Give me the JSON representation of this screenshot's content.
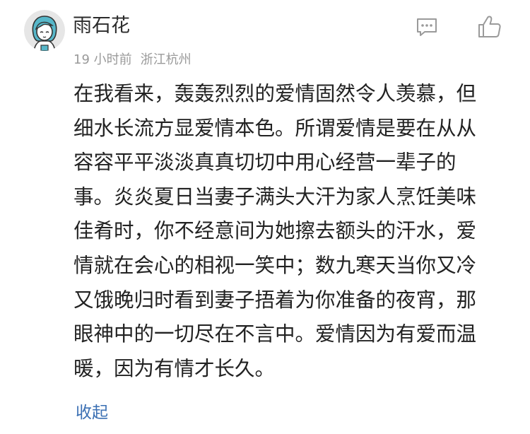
{
  "comment": {
    "username": "雨石花",
    "time": "19 小时前",
    "location": "浙江杭州",
    "avatar_icon": "avatar-icon",
    "actions": {
      "reply_icon": "comment-icon",
      "like_icon": "thumbs-up-icon"
    },
    "content_lines": [
      "在我看来，轰轰烈烈的爱情固然令人羡慕，但",
      "细水长流方显爱情本色。所谓爱情是要在从从",
      "容容平平淡淡真真切切中用心经营一辈子的",
      "事。炎炎夏日当妻子满头大汗为家人烹饪美味",
      "佳肴时，你不经意间为她擦去额头的汗水，爱",
      "情就在会心的相视一笑中；数九寒天当你又冷",
      "又饿晚归时看到妻子捂着为你准备的夜宵，那",
      "眼神中的一切尽在不言中。爱情因为有爱而温",
      "暖，因为有情才长久。"
    ],
    "collapse_label": "收起"
  },
  "colors": {
    "username": "#2b2b2b",
    "meta": "#9a9a9a",
    "body_text": "#222222",
    "link": "#3a6fb3",
    "icon_gray": "#9a9a9a",
    "avatar_bg": "#e6e6e6",
    "avatar_hair": "#57b7c9"
  }
}
